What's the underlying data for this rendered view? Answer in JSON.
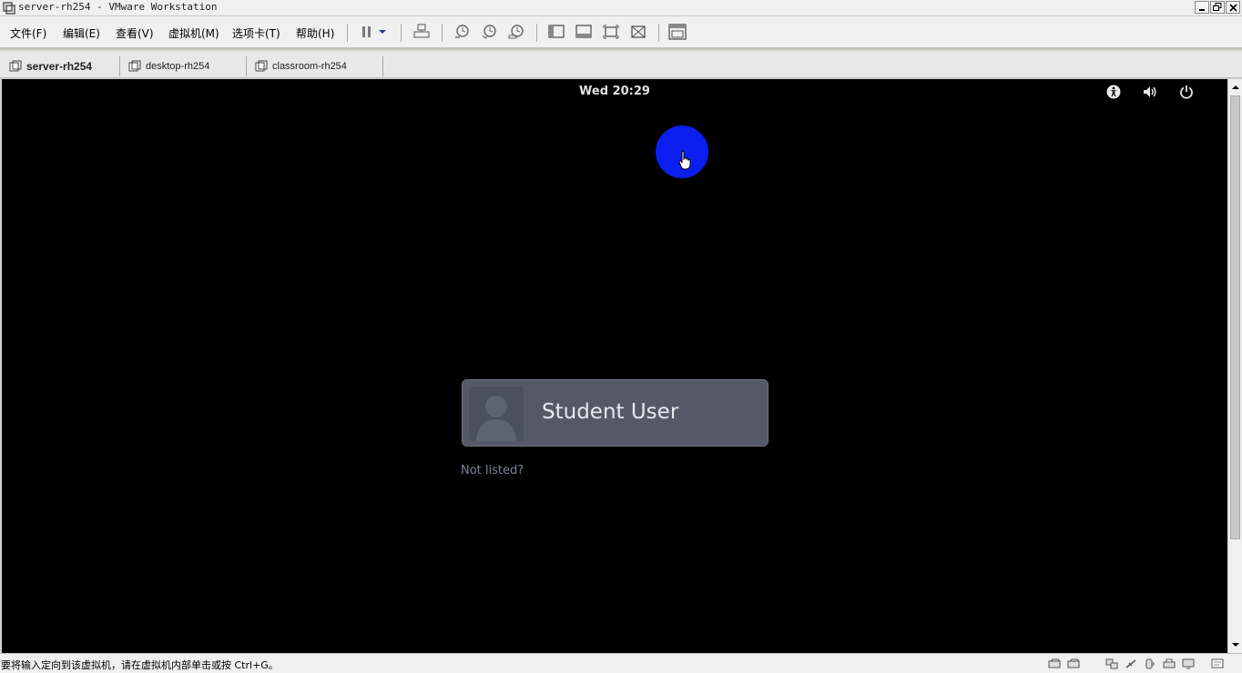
{
  "window": {
    "title": "server-rh254 - VMware Workstation"
  },
  "menu": {
    "items": [
      "文件(F)",
      "编辑(E)",
      "查看(V)",
      "虚拟机(M)",
      "选项卡(T)",
      "帮助(H)"
    ]
  },
  "toolbar": {
    "icons": [
      "pause-icon",
      "dropdown-arrow-icon",
      "send-ctrl-alt-del-icon",
      "snapshot-take-icon",
      "snapshot-revert-icon",
      "snapshot-manager-icon",
      "console-view-icon",
      "thumbnail-bar-icon",
      "fullscreen-icon",
      "unity-icon",
      "library-view-icon"
    ]
  },
  "tabs": [
    {
      "label": "server-rh254",
      "active": true
    },
    {
      "label": "desktop-rh254",
      "active": false
    },
    {
      "label": "classroom-rh254",
      "active": false
    }
  ],
  "vm": {
    "clock": "Wed 20:29",
    "system_icons": [
      "accessibility-icon",
      "volume-icon",
      "power-icon"
    ],
    "login": {
      "user_name": "Student User",
      "not_listed": "Not listed?"
    }
  },
  "statusbar": {
    "message": "要将输入定向到该虚拟机，请在虚拟机内部单击或按 Ctrl+G。",
    "icons": [
      "hdd-icon",
      "hdd-2-icon",
      "network-icon",
      "usb-icon",
      "audio-icon",
      "printer-icon",
      "display-icon",
      "message-icon"
    ]
  },
  "colors": {
    "vm_background": "#000000",
    "cursor_highlight": "#0a1ef0",
    "login_card": "#535a66"
  }
}
